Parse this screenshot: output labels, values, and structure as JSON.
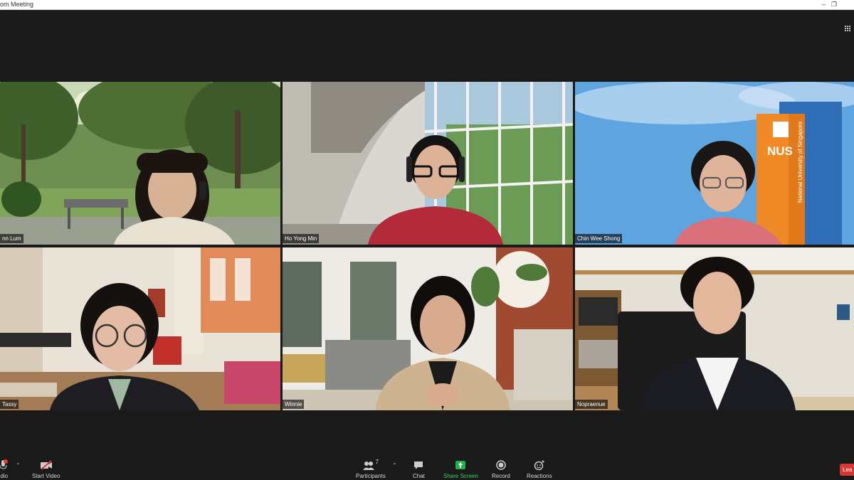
{
  "window": {
    "title": "om Meeting"
  },
  "participants": [
    {
      "name": "nn Lum",
      "scene": "garden",
      "shirt": "#e8e0d0",
      "hair": "#1c1410"
    },
    {
      "name": "Ho Yong Min",
      "scene": "atrium",
      "shirt": "#b32a3a",
      "hair": "#151212"
    },
    {
      "name": "Chin Wee Shong",
      "scene": "nus",
      "shirt": "#d9707a",
      "hair": "#1b1616",
      "tower_text": "NUS",
      "tower_subtext": "National University of Singapore"
    },
    {
      "name": "Tassy",
      "scene": "living",
      "shirt": "#1d1d22",
      "hair": "#15110f"
    },
    {
      "name": "Winnie",
      "scene": "loft",
      "shirt": "#cdb38f",
      "hair": "#100d0c"
    },
    {
      "name": "Nopraenue",
      "scene": "office",
      "shirt": "#1b1c22",
      "hair": "#120f0d",
      "active": true
    }
  ],
  "toolbar": {
    "audio_label": "udio",
    "video_label": "Start Video",
    "participants_label": "Participants",
    "participants_count": "7",
    "chat_label": "Chat",
    "share_label": "Share Screen",
    "record_label": "Record",
    "reactions_label": "Reactions",
    "leave_label": "Lea"
  },
  "colors": {
    "share_green": "#22b14c",
    "leave_red": "#d43a33",
    "active_outline": "#e7e36a"
  }
}
